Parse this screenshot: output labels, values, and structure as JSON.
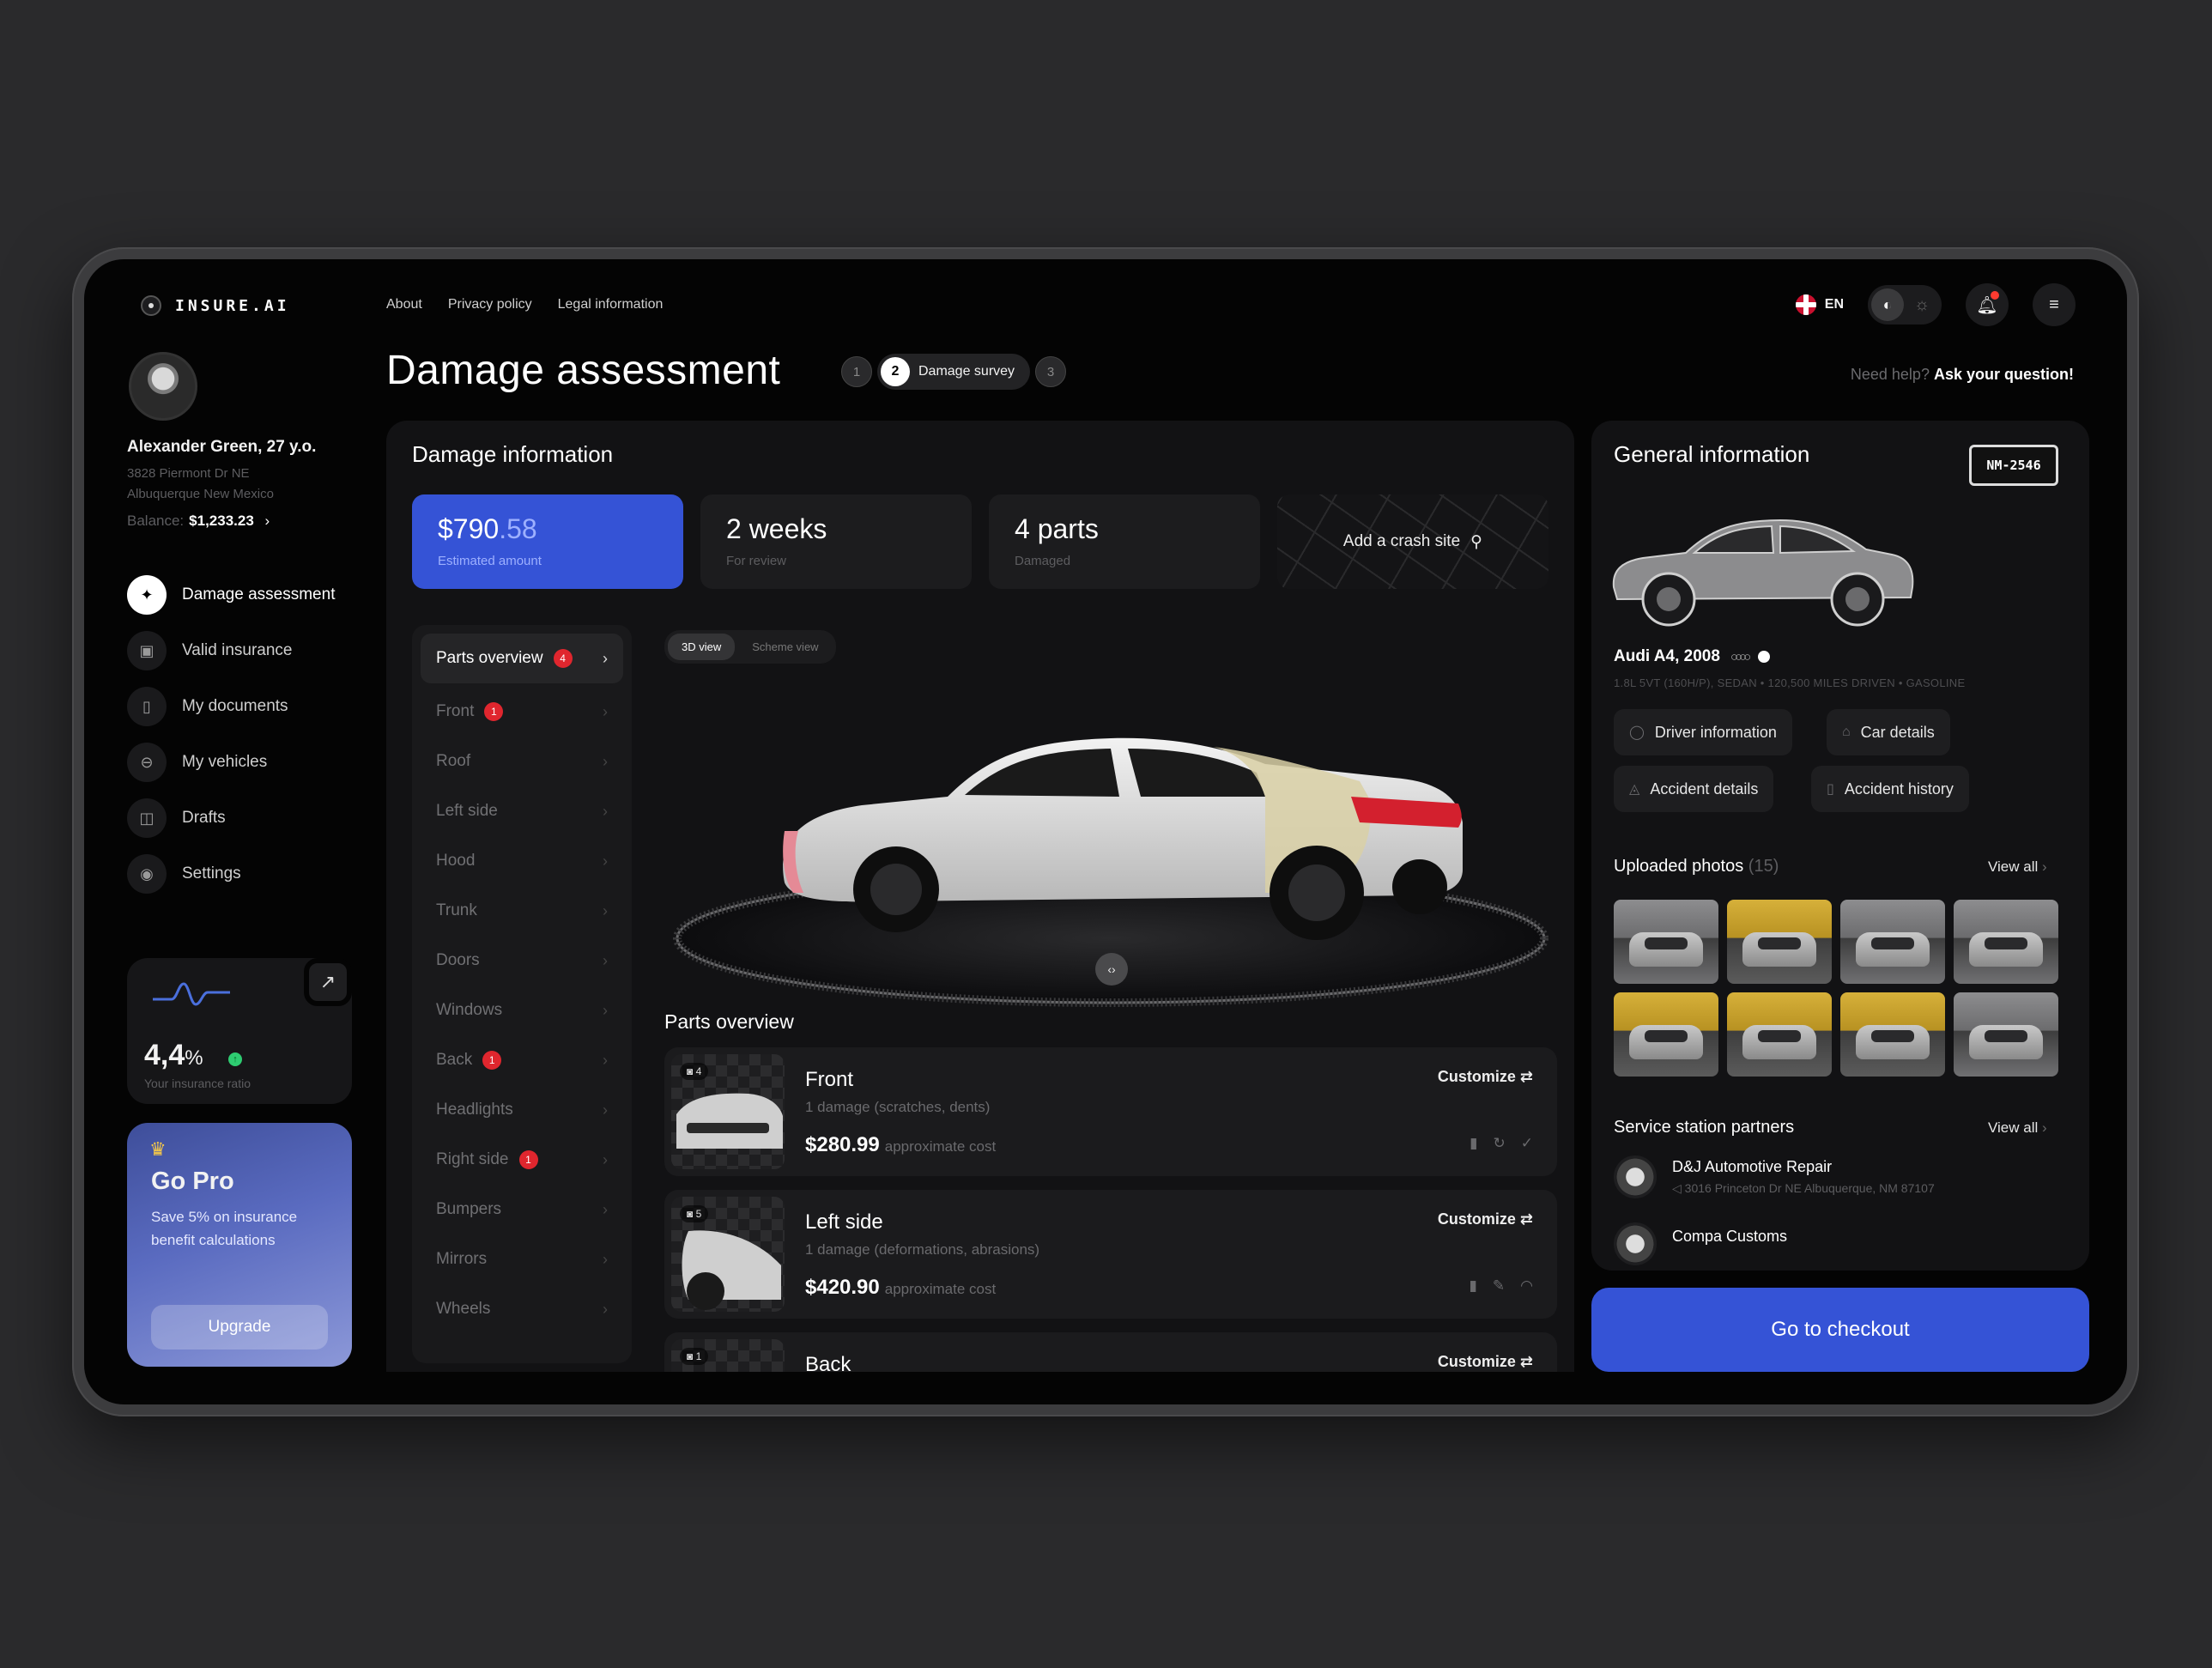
{
  "brand": {
    "name": "INSURE.AI"
  },
  "topnav": [
    "About",
    "Privacy policy",
    "Legal information"
  ],
  "lang": "EN",
  "user": {
    "name": "Alexander Green, 27 y.o.",
    "address_line1": "3828 Piermont Dr NE",
    "address_line2": "Albuquerque New Mexico",
    "balance_label": "Balance:",
    "balance_value": "$1,233.23",
    "balance_chevron": "›"
  },
  "menu": [
    {
      "label": "Damage assessment",
      "icon": "sparkle-icon",
      "glyph": "✦"
    },
    {
      "label": "Valid insurance",
      "icon": "document-check-icon",
      "glyph": "▣"
    },
    {
      "label": "My documents",
      "icon": "file-icon",
      "glyph": "▯"
    },
    {
      "label": "My vehicles",
      "icon": "car-icon",
      "glyph": "⊖"
    },
    {
      "label": "Drafts",
      "icon": "trash-icon",
      "glyph": "◫"
    },
    {
      "label": "Settings",
      "icon": "gear-icon",
      "glyph": "◉"
    }
  ],
  "ratio": {
    "value": "4,4",
    "unit": "%",
    "label": "Your insurance ratio",
    "arrow": "↗",
    "trend": "↑"
  },
  "pro": {
    "crown": "♛",
    "title": "Go Pro",
    "text": "Save 5% on insurance benefit calculations",
    "button": "Upgrade"
  },
  "header": {
    "title": "Damage assessment",
    "steps": [
      "1",
      "2",
      "3"
    ],
    "active_step_label": "Damage survey",
    "help_prefix": "Need help?",
    "help_link": "Ask your question!"
  },
  "damage": {
    "title": "Damage information",
    "amount_main": "$790",
    "amount_cents": ".58",
    "amount_label": "Estimated amount",
    "weeks": "2 weeks",
    "weeks_label": "For review",
    "parts": "4 parts",
    "parts_label": "Damaged",
    "crash_site": "Add a crash site",
    "crash_icon": "⚲"
  },
  "parts_list": [
    {
      "label": "Parts overview",
      "badge": "4"
    },
    {
      "label": "Front",
      "badge": "1"
    },
    {
      "label": "Roof",
      "badge": ""
    },
    {
      "label": "Left side",
      "badge": ""
    },
    {
      "label": "Hood",
      "badge": ""
    },
    {
      "label": "Trunk",
      "badge": ""
    },
    {
      "label": "Doors",
      "badge": ""
    },
    {
      "label": "Windows",
      "badge": ""
    },
    {
      "label": "Back",
      "badge": "1"
    },
    {
      "label": "Headlights",
      "badge": ""
    },
    {
      "label": "Right side",
      "badge": "1"
    },
    {
      "label": "Bumpers",
      "badge": ""
    },
    {
      "label": "Mirrors",
      "badge": ""
    },
    {
      "label": "Wheels",
      "badge": ""
    }
  ],
  "view_toggle": [
    "3D view",
    "Scheme view"
  ],
  "drag_icon": "‹›",
  "parts_overview": {
    "title": "Parts overview",
    "customize_icon": "⇄",
    "items": [
      {
        "name": "Front",
        "count": "◙ 4",
        "desc": "1 damage (scratches, dents)",
        "cost": "$280.99",
        "cost_label": "approximate cost",
        "customize": "Customize",
        "actions": [
          "▮",
          "↻",
          "✓"
        ]
      },
      {
        "name": "Left side",
        "count": "◙ 5",
        "desc": "1 damage (deformations, abrasions)",
        "cost": "$420.90",
        "cost_label": "approximate cost",
        "customize": "Customize",
        "actions": [
          "▮",
          "✎",
          "◠"
        ]
      },
      {
        "name": "Back",
        "count": "◙ 1",
        "desc": "",
        "cost": "",
        "cost_label": "",
        "customize": "Customize",
        "actions": []
      }
    ]
  },
  "general": {
    "title": "General information",
    "plate": "NM-2546",
    "model": "Audi A4, 2008",
    "rings": "○○○○",
    "specs": "1.8L 5VT (160H/P), SEDAN  •  120,500 MILES DRIVEN  •  GASOLINE",
    "chips": [
      {
        "label": "Driver information",
        "icon": "user-icon",
        "glyph": "◯"
      },
      {
        "label": "Car details",
        "icon": "car-icon",
        "glyph": "⌂"
      },
      {
        "label": "Accident details",
        "icon": "lock-icon",
        "glyph": "◬"
      },
      {
        "label": "Accident history",
        "icon": "file-icon",
        "glyph": "▯"
      }
    ],
    "photos_title": "Uploaded photos",
    "photos_count": "(15)",
    "view_all": "View all",
    "view_all_chevron": "›",
    "photos": [
      "gry",
      "yel",
      "gry",
      "gry",
      "yel",
      "yel",
      "yel",
      "gry"
    ],
    "partners_title": "Service station partners",
    "partners": [
      {
        "name": "D&J Automotive Repair",
        "address": "3016 Princeton Dr NE Albuquerque, NM 87107",
        "pin": "◁"
      },
      {
        "name": "Compa Customs",
        "address": "",
        "pin": ""
      }
    ]
  },
  "checkout": "Go to checkout",
  "colors": {
    "accent": "#3553d6",
    "badge": "#e0262e",
    "positive": "#2ecc71",
    "background": "#040404"
  }
}
